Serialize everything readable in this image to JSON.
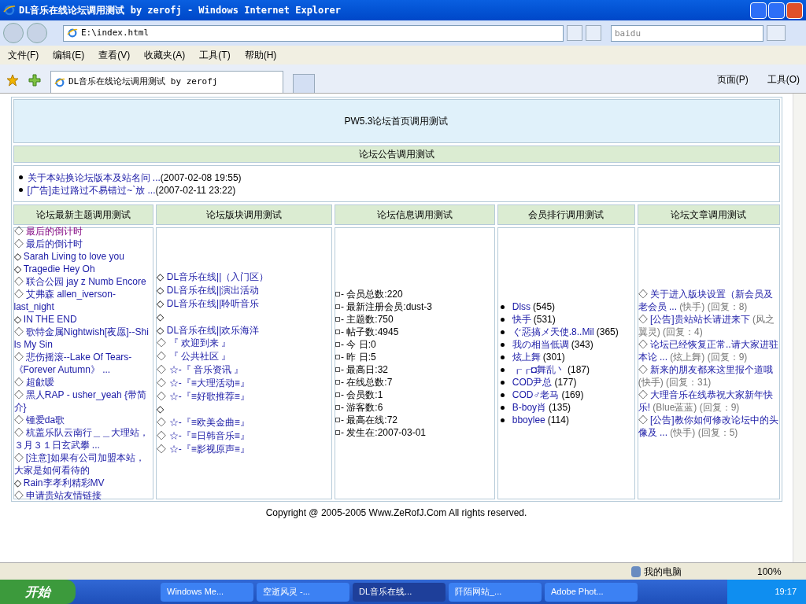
{
  "window": {
    "title": "DL音乐在线论坛调用测试 by zerofj - Windows Internet Explorer"
  },
  "address_bar": {
    "value": "E:\\index.html"
  },
  "search": {
    "placeholder": "baidu"
  },
  "menu": [
    "文件(F)",
    "编辑(E)",
    "查看(V)",
    "收藏夹(A)",
    "工具(T)",
    "帮助(H)"
  ],
  "tabs": [
    {
      "label": "DL音乐在线论坛调用测试 by zerofj",
      "selected": true
    }
  ],
  "command_bar": [
    "页面(P)",
    "工具(O)"
  ],
  "page": {
    "banner": "PW5.3论坛首页调用测试",
    "notice_heading": "论坛公告调用测试",
    "notices": [
      {
        "title": "关于本站换论坛版本及站名问 ...",
        "date": "(2007-02-08 19:55)"
      },
      {
        "title": "[广告]走过路过不易错过~`放 ...",
        "date": "(2007-02-11 23:22)"
      }
    ],
    "columns": [
      {
        "heading": "论坛最新主题调用测试",
        "kind": "topics",
        "items": [
          {
            "marker": "◇",
            "text": "最后的倒计时",
            "visited": true
          },
          {
            "marker": "◇",
            "text": "最后的倒计时",
            "visited": false
          },
          {
            "marker": "◇",
            "text": "Sarah Living to love you",
            "visited": false
          },
          {
            "marker": "◇",
            "text": "Tragedie Hey Oh",
            "visited": false
          },
          {
            "marker": "◇",
            "text": "联合公园 jay z Numb Encore",
            "visited": false
          },
          {
            "marker": "◇",
            "text": "艾弗森  allen_iverson-last_night",
            "visited": false
          },
          {
            "marker": "◇",
            "text": "IN THE END",
            "visited": false
          },
          {
            "marker": "◇",
            "text": "歌特金属Nightwish[夜愿]--Shi Is My Sin",
            "visited": false
          },
          {
            "marker": "◇",
            "text": "悲伤摇滚--Lake Of Tears-《Forever Autumn》  ...",
            "visited": false
          },
          {
            "marker": "◇",
            "text": "超歈嗳",
            "visited": false
          },
          {
            "marker": "◇",
            "text": "黑人RAP - usher_yeah {带简介}",
            "visited": false
          },
          {
            "marker": "◇",
            "text": "锺爱da歌",
            "visited": false
          },
          {
            "marker": "◇",
            "text": "杭盖乐队云南行＿＿大理站，３月３１日玄武攀 ...",
            "visited": false
          },
          {
            "marker": "◇",
            "text": "[注意]如果有公司加盟本站，大家是如何看待的",
            "visited": false
          },
          {
            "marker": "◇",
            "text": "Rain李孝利精彩MV",
            "visited": false
          },
          {
            "marker": "◇",
            "text": "申请贵站友情链接",
            "visited": false
          }
        ]
      },
      {
        "heading": "论坛版块调用测试",
        "kind": "boards",
        "items": [
          {
            "marker": "◇",
            "text": "DL音乐在线||（入门区）"
          },
          {
            "marker": "◇",
            "text": "DL音乐在线||演出活动"
          },
          {
            "marker": "◇",
            "text": "DL音乐在线||聆听音乐"
          },
          {
            "marker": "◇"
          },
          {
            "marker": "◇",
            "text": "DL音乐在线||欢乐海洋"
          },
          {
            "marker": "◇",
            "text": "『 欢迎到来 』"
          },
          {
            "marker": "◇",
            "text": "『 公共社区 』"
          },
          {
            "marker": "◇",
            "text": "☆-『 音乐资讯 』"
          },
          {
            "marker": "◇",
            "text": "☆-『≡大理活动≡』"
          },
          {
            "marker": "◇",
            "text": "☆-『≡好歌推荐≡』"
          },
          {
            "marker": "◇"
          },
          {
            "marker": "◇",
            "text": "☆-『≡欧美金曲≡』"
          },
          {
            "marker": "◇",
            "text": "☆-『≡日韩音乐≡』"
          },
          {
            "marker": "◇",
            "text": "☆-『≡影视原声≡』"
          }
        ]
      },
      {
        "heading": "论坛信息调用测试",
        "kind": "stats",
        "items": [
          {
            "text": "- 会员总数:220"
          },
          {
            "text": "- 最新注册会员:dust-3"
          },
          {
            "text": "- 主题数:750"
          },
          {
            "text": "- 帖子数:4945"
          },
          {
            "text": "- 今  日:0"
          },
          {
            "text": "- 昨  日:5"
          },
          {
            "text": "- 最高日:32"
          },
          {
            "text": "- 在线总数:7"
          },
          {
            "text": "- 会员数:1"
          },
          {
            "text": "- 游客数:6"
          },
          {
            "text": "- 最高在线:72"
          },
          {
            "text": "- 发生在:2007-03-01"
          }
        ]
      },
      {
        "heading": "会员排行调用测试",
        "kind": "members",
        "items": [
          {
            "text": "Dlss",
            "count": "(545)"
          },
          {
            "text": "快手",
            "count": "(531)"
          },
          {
            "text": "ぐ惡搞メ天使.8..Mil",
            "count": "(365)"
          },
          {
            "text": "我の相当低调",
            "count": "(343)"
          },
          {
            "text": "炫上舞",
            "count": "(301)"
          },
          {
            "text": "┎┎◘舞乱丶",
            "count": "(187)"
          },
          {
            "text": "COD尹总",
            "count": "(177)"
          },
          {
            "text": "COD♂老马",
            "count": "(169)"
          },
          {
            "text": "B-boy肖",
            "count": "(135)"
          },
          {
            "text": "bboylee",
            "count": "(114)"
          }
        ]
      },
      {
        "heading": "论坛文章调用测试",
        "kind": "articles",
        "items": [
          {
            "marker": "◇",
            "text": "关于进入版块设置（新会员及老会员 ...",
            "author": "(快手)",
            "replies": "(回复：8)"
          },
          {
            "marker": "◇",
            "text": "[公告]贵站站长请进来下",
            "author": "(风之翼灵)",
            "replies": "(回复：4)"
          },
          {
            "marker": "◇",
            "text": "论坛已经恢复正常..请大家进驻本论 ...",
            "author": "(炫上舞)",
            "replies": "(回复：9)"
          },
          {
            "marker": "◇",
            "text": "新来的朋友都来这里报个道哦",
            "author": "(快手)",
            "replies": "(回复：31)"
          },
          {
            "marker": "◇",
            "text": "大理音乐在线恭祝大家新年快乐!",
            "author": "(Blue蓝蓝)",
            "replies": "(回复：9)"
          },
          {
            "marker": "◇",
            "text": "[公告]教你如何修改论坛中的头像及 ...",
            "author": "(快手)",
            "replies": "(回复：5)"
          }
        ]
      }
    ],
    "copyright": "Copyright @ 2005-2005 Www.ZeRofJ.Com All rights reserved."
  },
  "status_bar": {
    "zone": "我的电脑",
    "zoom": "100%"
  },
  "taskbar": {
    "start": "开始",
    "items": [
      {
        "label": "Windows Me...",
        "selected": false
      },
      {
        "label": "空逝风灵 -...",
        "selected": false
      },
      {
        "label": "DL音乐在线...",
        "selected": true
      },
      {
        "label": "阡陌网站_...",
        "selected": false
      },
      {
        "label": "Adobe Phot...",
        "selected": false
      }
    ],
    "clock": "19:17"
  }
}
